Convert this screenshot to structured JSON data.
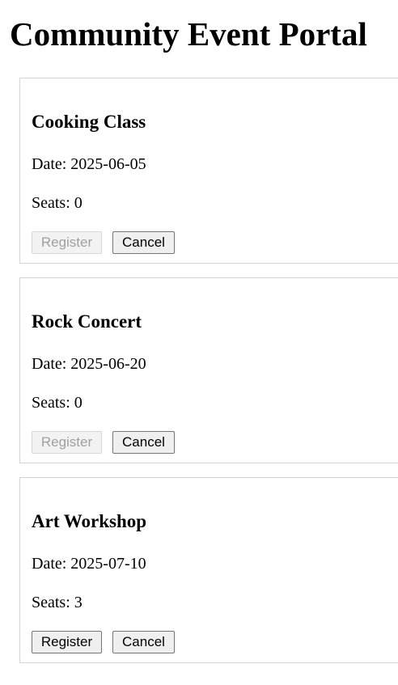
{
  "page": {
    "title": "Community Event Portal"
  },
  "events": [
    {
      "title": "Cooking Class",
      "date_text": "Date: 2025-06-05",
      "seats_text": "Seats: 0",
      "register_label": "Register",
      "cancel_label": "Cancel",
      "register_enabled": false
    },
    {
      "title": "Rock Concert",
      "date_text": "Date: 2025-06-20",
      "seats_text": "Seats: 0",
      "register_label": "Register",
      "cancel_label": "Cancel",
      "register_enabled": false
    },
    {
      "title": "Art Workshop",
      "date_text": "Date: 2025-07-10",
      "seats_text": "Seats: 3",
      "register_label": "Register",
      "cancel_label": "Cancel",
      "register_enabled": true
    }
  ]
}
